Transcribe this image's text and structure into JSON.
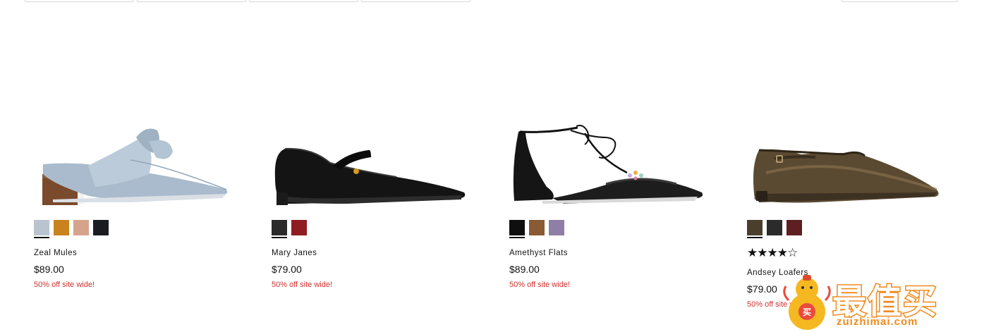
{
  "products": [
    {
      "name": "Zeal Mules",
      "price": "$89.00",
      "promo": "50% off site wide!",
      "swatches": [
        "#b9c4ce",
        "#c9821d",
        "#d6a38d",
        "#1b1c20"
      ],
      "selected_swatch": 0
    },
    {
      "name": "Mary Janes",
      "price": "$79.00",
      "promo": "50% off site wide!",
      "swatches": [
        "#2a2a2a",
        "#8e1c22"
      ],
      "selected_swatch": 0
    },
    {
      "name": "Amethyst Flats",
      "price": "$89.00",
      "promo": "50% off site wide!",
      "swatches": [
        "#0f0f0f",
        "#8a5a33",
        "#8f7fa6"
      ],
      "selected_swatch": 0
    },
    {
      "name": "Andsey Loafers",
      "price": "$79.00",
      "promo": "50% off site wide!",
      "rating": 4.5,
      "stars": "★★★★☆",
      "swatches": [
        "#4a3f2c",
        "#2b2b2b",
        "#5e1f22"
      ],
      "selected_swatch": 0
    }
  ],
  "watermark": {
    "cn": "最值买",
    "en": "zuizhimai.com"
  }
}
